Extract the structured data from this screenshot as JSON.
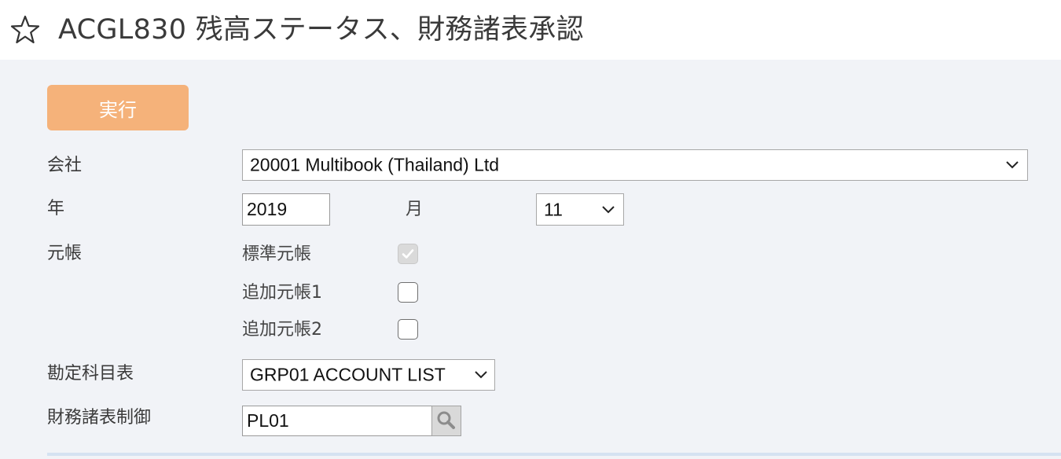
{
  "header": {
    "title": "ACGL830 残高ステータス、財務諸表承認",
    "favorite_icon": "star-outline-icon"
  },
  "toolbar": {
    "run_label": "実行",
    "run_color": "#f5b27a"
  },
  "form": {
    "company": {
      "label": "会社",
      "value": "20001 Multibook (Thailand) Ltd"
    },
    "year": {
      "label": "年",
      "value": "2019"
    },
    "month": {
      "label": "月",
      "value": "11"
    },
    "ledger": {
      "label": "元帳",
      "options": [
        {
          "label": "標準元帳",
          "checked": true,
          "disabled": true
        },
        {
          "label": "追加元帳1",
          "checked": false,
          "disabled": false
        },
        {
          "label": "追加元帳2",
          "checked": false,
          "disabled": false
        }
      ]
    },
    "chart_of_accounts": {
      "label": "勘定科目表",
      "value": "GRP01 ACCOUNT LIST"
    },
    "fs_control": {
      "label": "財務諸表制御",
      "value": "PL01",
      "lookup_icon": "magnifier-icon"
    }
  },
  "colors": {
    "panel_bg": "#f1f3f7",
    "accent": "#f5b27a"
  }
}
